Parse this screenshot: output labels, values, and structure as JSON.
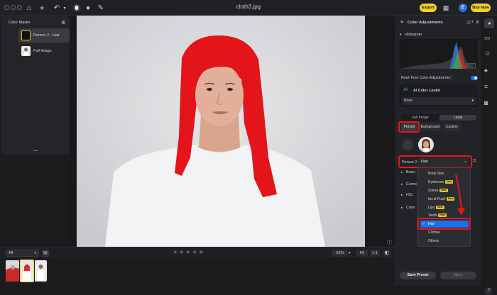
{
  "window": {
    "title": "cloth3.jpg"
  },
  "topbar": {
    "export_label": "Export",
    "avatar_letter": "E",
    "buy_label": "Buy Now"
  },
  "mask_panel": {
    "title": "Color Masks",
    "items": [
      {
        "label": "Person 2 - Hair",
        "selected": true
      },
      {
        "label": "Full Image",
        "selected": false
      }
    ]
  },
  "canvas": {
    "zoom": "52%",
    "fit_label": "Fit",
    "ratio_label": "1:1",
    "rating_stars": 5
  },
  "filmstrip": {
    "filter": "All"
  },
  "right_panel": {
    "title": "Color Adjustments",
    "histogram_label": "Histogram",
    "histogram_tag": "JPEG",
    "realtime_label": "Real-Time Color Adjustments",
    "ai_looks_label": "AI Color Looks",
    "ai_looks_value": "None",
    "scope_tabs": [
      "Full Image",
      "Local"
    ],
    "local_tabs": [
      "Person",
      "Background",
      "Custom"
    ],
    "person_label": "Person 2:",
    "part_value": "Hair",
    "sections": [
      "Basic",
      "Curves",
      "HSL",
      "Color"
    ],
    "save_preset": "Save Preset",
    "sync_label": "Sync"
  },
  "dropdown": {
    "items": [
      {
        "label": "Body Skin",
        "new": false,
        "checked": false
      },
      {
        "label": "Eyebrows",
        "new": true,
        "checked": false
      },
      {
        "label": "Sclera",
        "new": true,
        "checked": false
      },
      {
        "label": "Iris & Pupil",
        "new": true,
        "checked": false
      },
      {
        "label": "Lips",
        "new": true,
        "checked": false
      },
      {
        "label": "Teeth",
        "new": true,
        "checked": false
      },
      {
        "label": "Hair",
        "new": false,
        "checked": true
      },
      {
        "label": "Clothes",
        "new": false,
        "checked": false
      },
      {
        "label": "Others",
        "new": false,
        "checked": false
      }
    ],
    "new_tag": "New"
  },
  "colors": {
    "accent_red": "#e3161e",
    "accent_yellow": "#f0d12e",
    "selection_blue": "#1e6fe8",
    "hair_red": "#e4141b"
  }
}
